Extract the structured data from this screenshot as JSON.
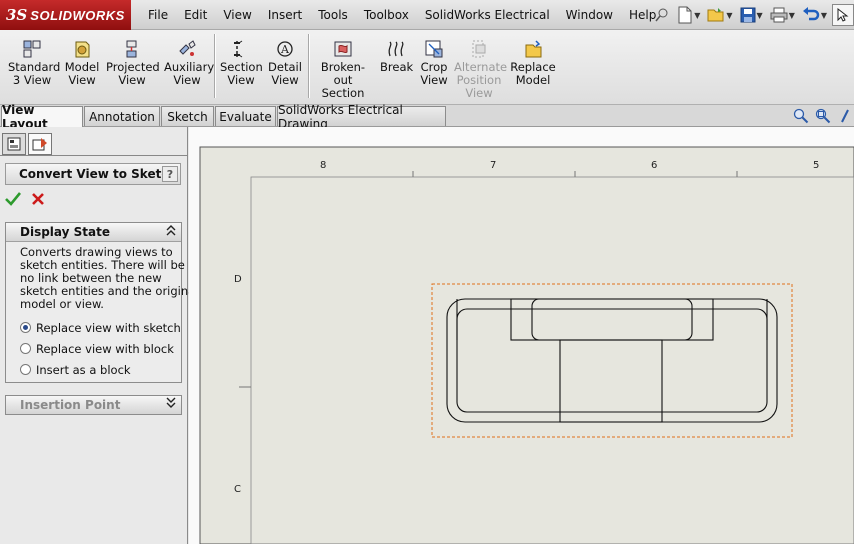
{
  "app": {
    "logo_prefix": "3S",
    "logo_text": "SOLIDWORKS"
  },
  "menu": [
    "File",
    "Edit",
    "View",
    "Insert",
    "Tools",
    "Toolbox",
    "SolidWorks Electrical",
    "Window",
    "Help"
  ],
  "ribbon": {
    "standard_3_view": [
      "Standard",
      "3 View"
    ],
    "model_view": [
      "Model",
      "View"
    ],
    "projected_view": [
      "Projected",
      "View"
    ],
    "auxiliary_view": [
      "Auxiliary",
      "View"
    ],
    "section_view": [
      "Section",
      "View"
    ],
    "detail_view": [
      "Detail",
      "View"
    ],
    "broken_out_section": [
      "Broken-out",
      "Section"
    ],
    "break": [
      "Break"
    ],
    "crop_view": [
      "Crop",
      "View"
    ],
    "alternate_position_view": [
      "Alternate",
      "Position",
      "View"
    ],
    "replace_model": [
      "Replace",
      "Model"
    ]
  },
  "tabs": [
    "View Layout",
    "Annotation",
    "Sketch",
    "Evaluate",
    "SolidWorks Electrical Drawing"
  ],
  "property_manager": {
    "title": "Convert View to Sketch",
    "help": "?",
    "display_state": {
      "header": "Display State",
      "description": [
        "Converts drawing views to",
        "sketch entities. There will be",
        "no link between the new",
        "sketch entities and the original",
        "model or view."
      ],
      "options": [
        {
          "label": "Replace view with sketch",
          "selected": true
        },
        {
          "label": "Replace view with block",
          "selected": false
        },
        {
          "label": "Insert as a block",
          "selected": false
        }
      ]
    },
    "insertion_point": {
      "header": "Insertion Point"
    }
  },
  "drawing": {
    "columns": [
      "8",
      "7",
      "6",
      "5"
    ],
    "rows": [
      "D",
      "C"
    ]
  },
  "colors": {
    "logo_red": "#b01c1c",
    "selection_orange": "#e0701a",
    "sheet_bg": "#e6e6de"
  }
}
